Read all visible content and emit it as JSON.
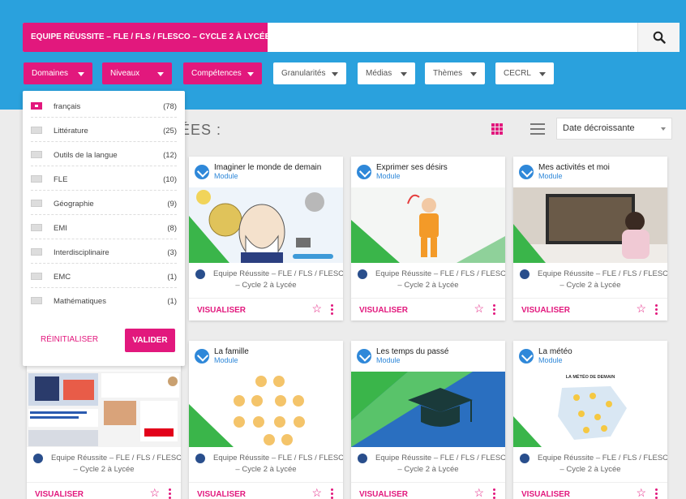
{
  "search": {
    "tag": "EQUIPE RÉUSSITE – FLE / FLS / FLESCO – CYCLE 2 À LYCÉE"
  },
  "filters": [
    {
      "label": "Domaines"
    },
    {
      "label": "Niveaux"
    },
    {
      "label": "Compétences"
    },
    {
      "label": "Granularités"
    },
    {
      "label": "Médias"
    },
    {
      "label": "Thèmes"
    },
    {
      "label": "CECRL"
    }
  ],
  "heading": "ÉES :",
  "sort": {
    "value": "Date décroissante"
  },
  "dropdown": {
    "items": [
      {
        "label": "français",
        "count": "(78)",
        "checked": true
      },
      {
        "label": "Littérature",
        "count": "(25)",
        "checked": false
      },
      {
        "label": "Outils de la langue",
        "count": "(12)",
        "checked": false
      },
      {
        "label": "FLE",
        "count": "(10)",
        "checked": false
      },
      {
        "label": "Géographie",
        "count": "(9)",
        "checked": false
      },
      {
        "label": "EMI",
        "count": "(8)",
        "checked": false
      },
      {
        "label": "Interdisciplinaire",
        "count": "(3)",
        "checked": false
      },
      {
        "label": "EMC",
        "count": "(1)",
        "checked": false
      },
      {
        "label": "Mathématiques",
        "count": "(1)",
        "checked": false
      }
    ],
    "reset_label": "RÉINITIALISER",
    "apply_label": "VALIDER"
  },
  "cards": [
    {
      "title": "Imaginer le monde de demain",
      "type": "Module",
      "author1": "Equipe Réussite – FLE / FLS / FLESCO",
      "author2": "– Cycle 2 à Lycée",
      "action": "VISUALISER"
    },
    {
      "title": "Exprimer ses désirs",
      "type": "Module",
      "author1": "Equipe Réussite – FLE / FLS / FLESCO",
      "author2": "– Cycle 2 à Lycée",
      "action": "VISUALISER"
    },
    {
      "title": "Mes activités et moi",
      "type": "Module",
      "author1": "Equipe Réussite – FLE / FLS / FLESCO",
      "author2": "– Cycle 2 à Lycée",
      "action": "VISUALISER"
    },
    {
      "title": "",
      "type": "",
      "author1": "Equipe Réussite – FLE / FLS / FLESCO",
      "author2": "– Cycle 2 à Lycée",
      "action": "VISUALISER"
    },
    {
      "title": "La famille",
      "type": "Module",
      "author1": "Equipe Réussite – FLE / FLS / FLESCO",
      "author2": "– Cycle 2 à Lycée",
      "action": "VISUALISER"
    },
    {
      "title": "Les temps du passé",
      "type": "Module",
      "author1": "Equipe Réussite – FLE / FLS / FLESCO",
      "author2": "– Cycle 2 à Lycée",
      "action": "VISUALISER"
    },
    {
      "title": "La météo",
      "type": "Module",
      "author1": "Equipe Réussite – FLE / FLS / FLESCO",
      "author2": "– Cycle 2 à Lycée",
      "action": "VISUALISER",
      "thumb_text": "LA MÉTÉO DE DEMAIN"
    }
  ],
  "colors": {
    "accent": "#e2187d",
    "header_blue": "#2aa1dd",
    "module_blue": "#2f88d9"
  }
}
